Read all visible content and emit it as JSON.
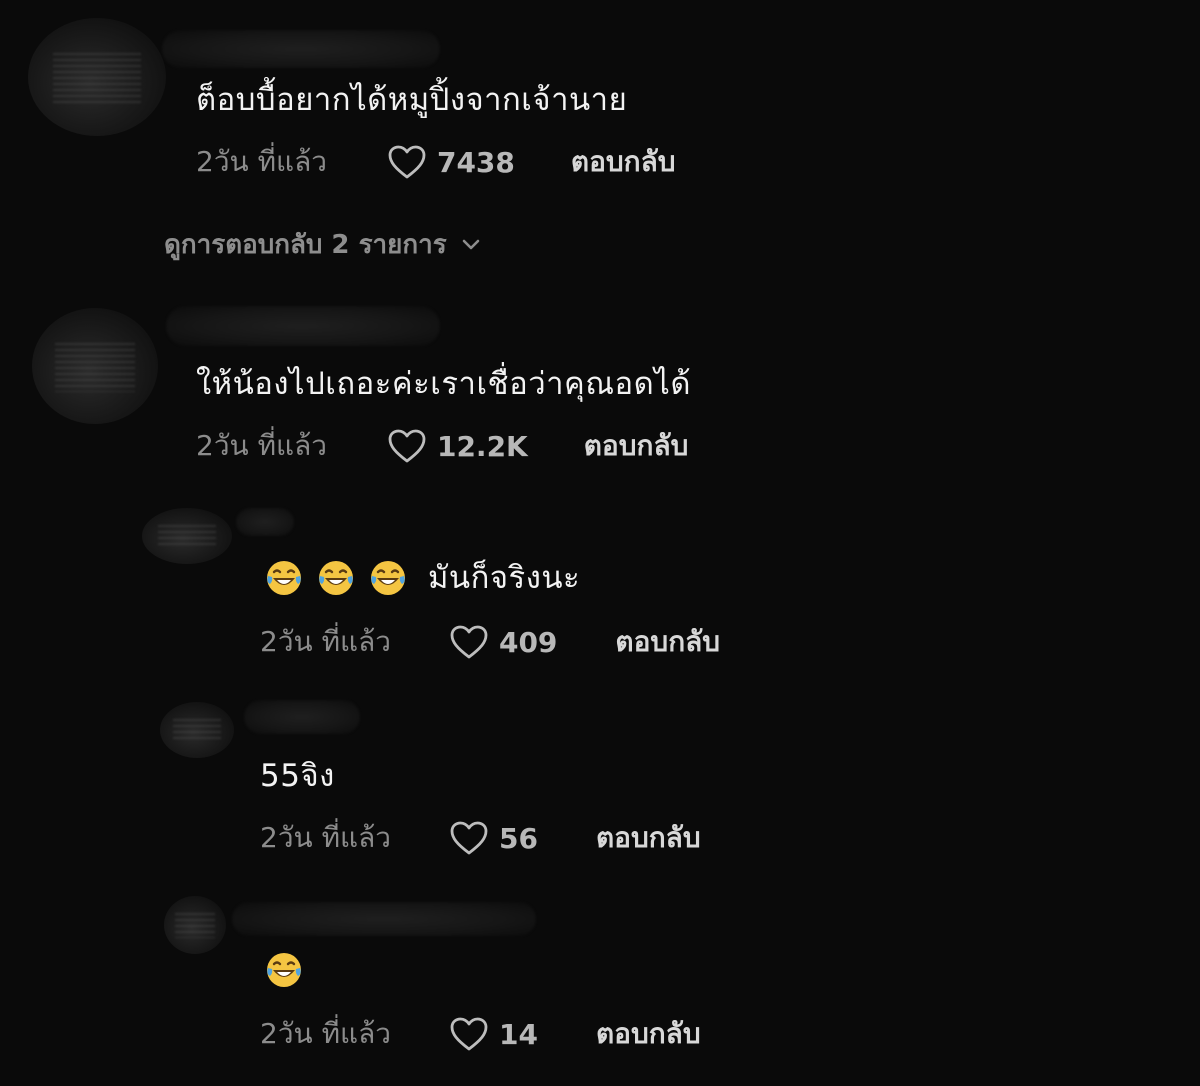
{
  "comments": [
    {
      "text": "ต็อบบื้อยากได้หมูปิ้งจากเจ้านาย",
      "time": "2วัน ที่แล้ว",
      "likes": "7438",
      "reply_label": "ตอบกลับ",
      "view_replies": "ดูการตอบกลับ 2 รายการ"
    },
    {
      "text": "ให้น้องไปเถอะค่ะเราเชื่อว่าคุณอดได้",
      "time": "2วัน ที่แล้ว",
      "likes": "12.2K",
      "reply_label": "ตอบกลับ"
    }
  ],
  "replies": [
    {
      "emoji_count": 3,
      "text": "มันก็จริงนะ",
      "time": "2วัน ที่แล้ว",
      "likes": "409",
      "reply_label": "ตอบกลับ"
    },
    {
      "text": "55จิง",
      "time": "2วัน ที่แล้ว",
      "likes": "56",
      "reply_label": "ตอบกลับ"
    },
    {
      "emoji_count": 1,
      "text": "",
      "time": "2วัน ที่แล้ว",
      "likes": "14",
      "reply_label": "ตอบกลับ"
    }
  ],
  "icons": {
    "like": "heart-outline-icon",
    "expand": "chevron-down-icon",
    "emoji": "face-with-tears-of-joy-icon"
  },
  "colors": {
    "background": "#0a0a0a",
    "text": "#f3f3f3",
    "muted": "#8c8c8c",
    "emoji": "#f4c542"
  }
}
